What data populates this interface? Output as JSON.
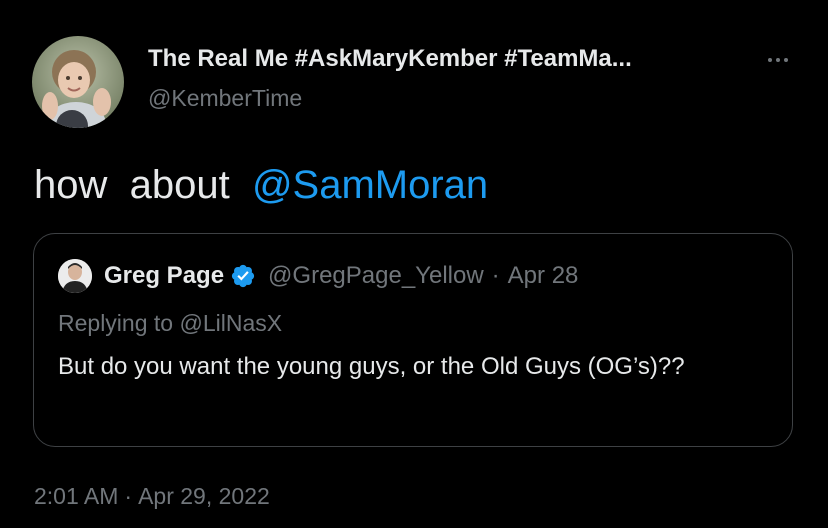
{
  "author": {
    "name": "The Real Me #AskMaryKember #TeamMa...",
    "handle": "@KemberTime"
  },
  "tweet": {
    "text_prefix": "how  about  ",
    "mention": "@SamMoran"
  },
  "quote": {
    "name": "Greg Page",
    "handle": "@GregPage_Yellow",
    "separator": "·",
    "date": "Apr 28",
    "replying_prefix": "Replying to ",
    "replying_to": "@LilNasX",
    "text": "But do you want the young guys, or the Old Guys (OG’s)??"
  },
  "footer": {
    "time": "2:01 AM",
    "separator": "·",
    "date": "Apr 29, 2022"
  },
  "icons": {
    "more": "more-horizontal-icon",
    "verified": "verified-badge-icon"
  },
  "colors": {
    "background": "#000000",
    "text": "#e7e9ea",
    "secondary": "#71767b",
    "accent": "#1d9bf0",
    "border": "#3e4144"
  }
}
